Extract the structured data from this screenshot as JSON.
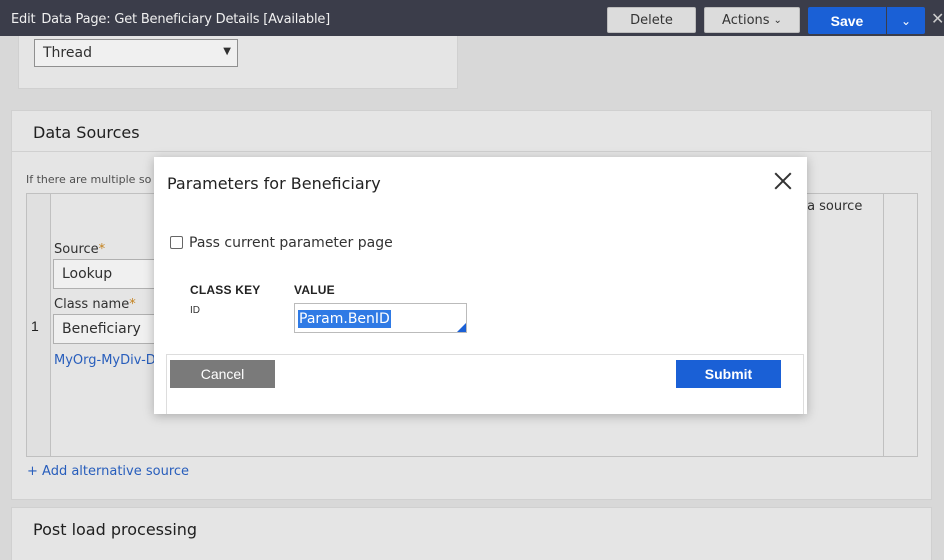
{
  "header": {
    "edit_label": "Edit",
    "title": "Data Page: Get Beneficiary Details [Available]",
    "delete_label": "Delete",
    "actions_label": "Actions",
    "save_label": "Save"
  },
  "scope": {
    "selected": "Thread"
  },
  "data_sources": {
    "heading": "Data Sources",
    "hint": "If there are multiple so",
    "row_number": "1",
    "source_label": "Source",
    "source_value": "Lookup",
    "class_name_label": "Class name",
    "class_name_value": "Beneficiary",
    "class_link": "MyOrg-MyDiv-Da",
    "right_text": "ata source",
    "add_alt_source": "+ Add alternative source",
    "required_mark": "*"
  },
  "post_load": {
    "heading": "Post load processing"
  },
  "modal": {
    "title": "Parameters for Beneficiary",
    "checkbox_label": "Pass current parameter page",
    "col_class_key": "CLASS KEY",
    "col_value": "VALUE",
    "row_key": "ID",
    "row_value": "Param.BenID",
    "cancel_label": "Cancel",
    "submit_label": "Submit"
  },
  "colors": {
    "primary": "#1a60d6",
    "header_bg": "#3b3d4a",
    "required": "#d08a20",
    "link": "#2b64c8"
  }
}
